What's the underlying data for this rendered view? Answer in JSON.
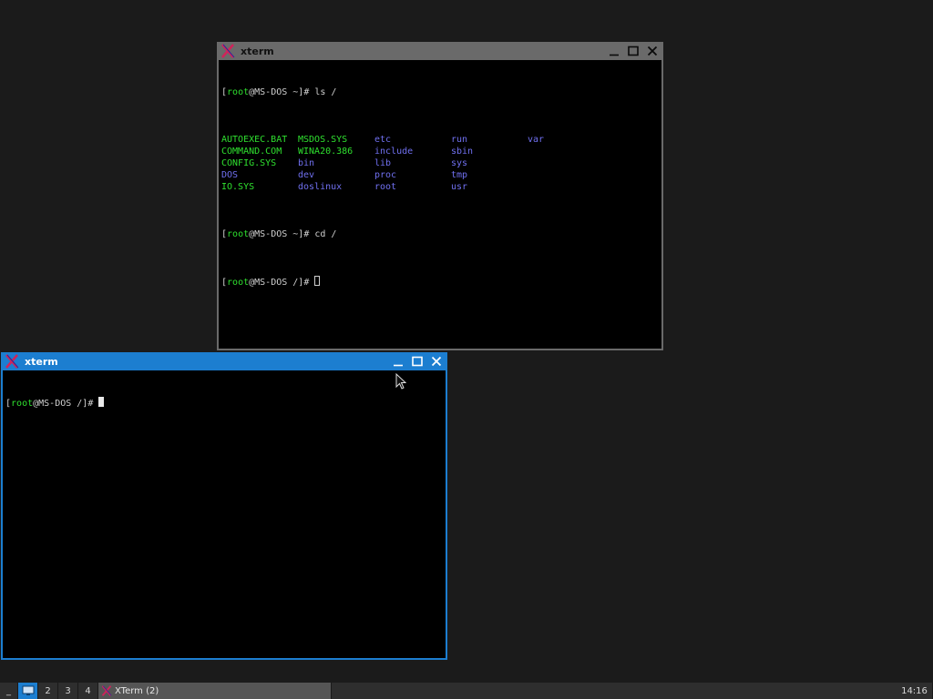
{
  "windows": {
    "top": {
      "title": "xterm",
      "lines": [
        {
          "pre": "[",
          "user": "root",
          "host": "@MS-DOS ~]# ",
          "cmd": "ls /"
        },
        {
          "pre": "[",
          "user": "root",
          "host": "@MS-DOS ~]# ",
          "cmd": "cd /"
        },
        {
          "pre": "[",
          "user": "root",
          "host": "@MS-DOS /]# ",
          "cmd": ""
        }
      ],
      "ls_grid": [
        [
          "AUTOEXEC.BAT",
          "MSDOS.SYS",
          "etc",
          "run",
          "var"
        ],
        [
          "COMMAND.COM",
          "WINA20.386",
          "include",
          "sbin",
          ""
        ],
        [
          "CONFIG.SYS",
          "bin",
          "lib",
          "sys",
          ""
        ],
        [
          "DOS",
          "dev",
          "proc",
          "tmp",
          ""
        ],
        [
          "IO.SYS",
          "doslinux",
          "root",
          "usr",
          ""
        ]
      ],
      "ls_colors": [
        [
          "green",
          "green",
          "blue",
          "blue",
          "blue"
        ],
        [
          "green",
          "green",
          "blue",
          "blue",
          ""
        ],
        [
          "green",
          "blue",
          "blue",
          "blue",
          ""
        ],
        [
          "blue",
          "blue",
          "blue",
          "blue",
          ""
        ],
        [
          "green",
          "blue",
          "blue",
          "blue",
          ""
        ]
      ]
    },
    "bottom": {
      "title": "xterm",
      "lines": [
        {
          "pre": "[",
          "user": "root",
          "host": "@MS-DOS /]# ",
          "cmd": ""
        }
      ]
    }
  },
  "taskbar": {
    "menu_label": "_",
    "workspaces": [
      "2",
      "3",
      "4"
    ],
    "task_label": "XTerm (2)",
    "clock": "14:16"
  },
  "colors": {
    "focused_border": "#1c7ed0",
    "unfocused_border": "#6a6a6a",
    "ls_green": "#2fe02f",
    "ls_blue": "#7070f0",
    "prompt_user": "#2fe02f"
  },
  "icons": {
    "app": "xterm-x-icon",
    "minimize": "minimize-icon",
    "maximize": "maximize-icon",
    "close": "close-icon",
    "desktop": "show-desktop-icon",
    "pointer": "mouse-pointer-icon"
  }
}
